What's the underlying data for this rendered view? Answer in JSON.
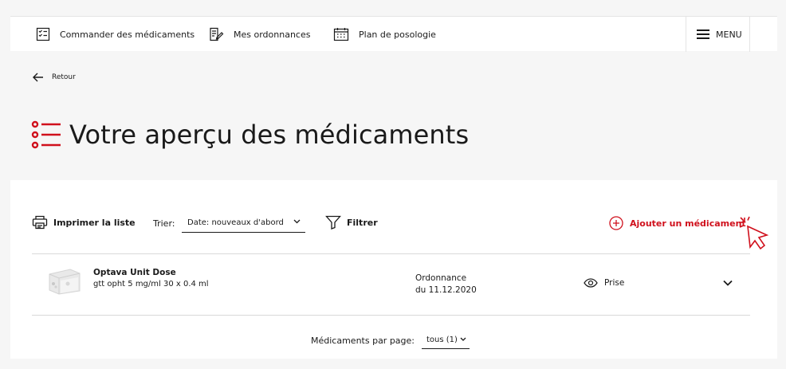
{
  "nav": {
    "order_label": "Commander des médicaments",
    "prescriptions_label": "Mes ordonnances",
    "dosage_label": "Plan de posologie",
    "menu_label": "MENU"
  },
  "back_label": "Retour",
  "page_title": "Votre aperçu des médicaments",
  "toolbar": {
    "print_label": "Imprimer la liste",
    "sort_label": "Trier:",
    "sort_value": "Date: nouveaux d'abord",
    "filter_label": "Filtrer",
    "add_label": "Ajouter un médicament"
  },
  "medications": [
    {
      "name": "Optava Unit Dose",
      "description": "gtt opht 5 mg/ml 30 x 0.4 ml",
      "prescription_line1": "Ordonnance",
      "prescription_line2": "du 11.12.2020",
      "action_label": "Prise"
    }
  ],
  "pagination": {
    "per_page_label": "Médicaments par page:",
    "per_page_value": "tous (1)"
  },
  "colors": {
    "accent": "#d0101c",
    "text": "#1a1a1a",
    "background": "#f6f6f6"
  }
}
